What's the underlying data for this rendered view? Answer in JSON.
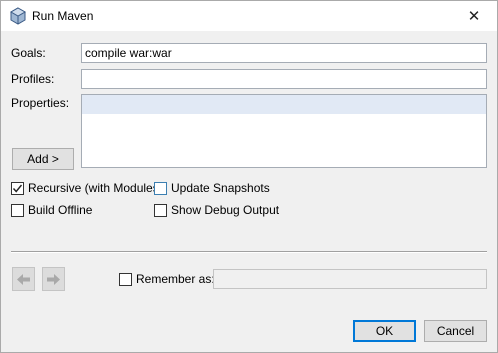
{
  "window": {
    "title": "Run Maven",
    "close_glyph": "✕"
  },
  "form": {
    "goals": {
      "label": "Goals:",
      "value": "compile war:war"
    },
    "profiles": {
      "label": "Profiles:",
      "value": ""
    },
    "properties": {
      "label": "Properties:",
      "value": ""
    },
    "add_button": "Add >"
  },
  "options": {
    "recursive": {
      "label": "Recursive (with Modules)",
      "checked": true
    },
    "update_snapshots": {
      "label": "Update Snapshots",
      "checked": false
    },
    "build_offline": {
      "label": "Build Offline",
      "checked": false
    },
    "show_debug": {
      "label": "Show Debug Output",
      "checked": false
    }
  },
  "history": {
    "back_icon": "arrow-left-icon",
    "forward_icon": "arrow-right-icon",
    "remember": {
      "label": "Remember as:",
      "checked": false,
      "value": ""
    }
  },
  "buttons": {
    "ok": "OK",
    "cancel": "Cancel"
  },
  "colors": {
    "accent": "#0078d7",
    "selection_row": "#e1e9f5",
    "disabled_arrow": "#a9a9a9"
  }
}
